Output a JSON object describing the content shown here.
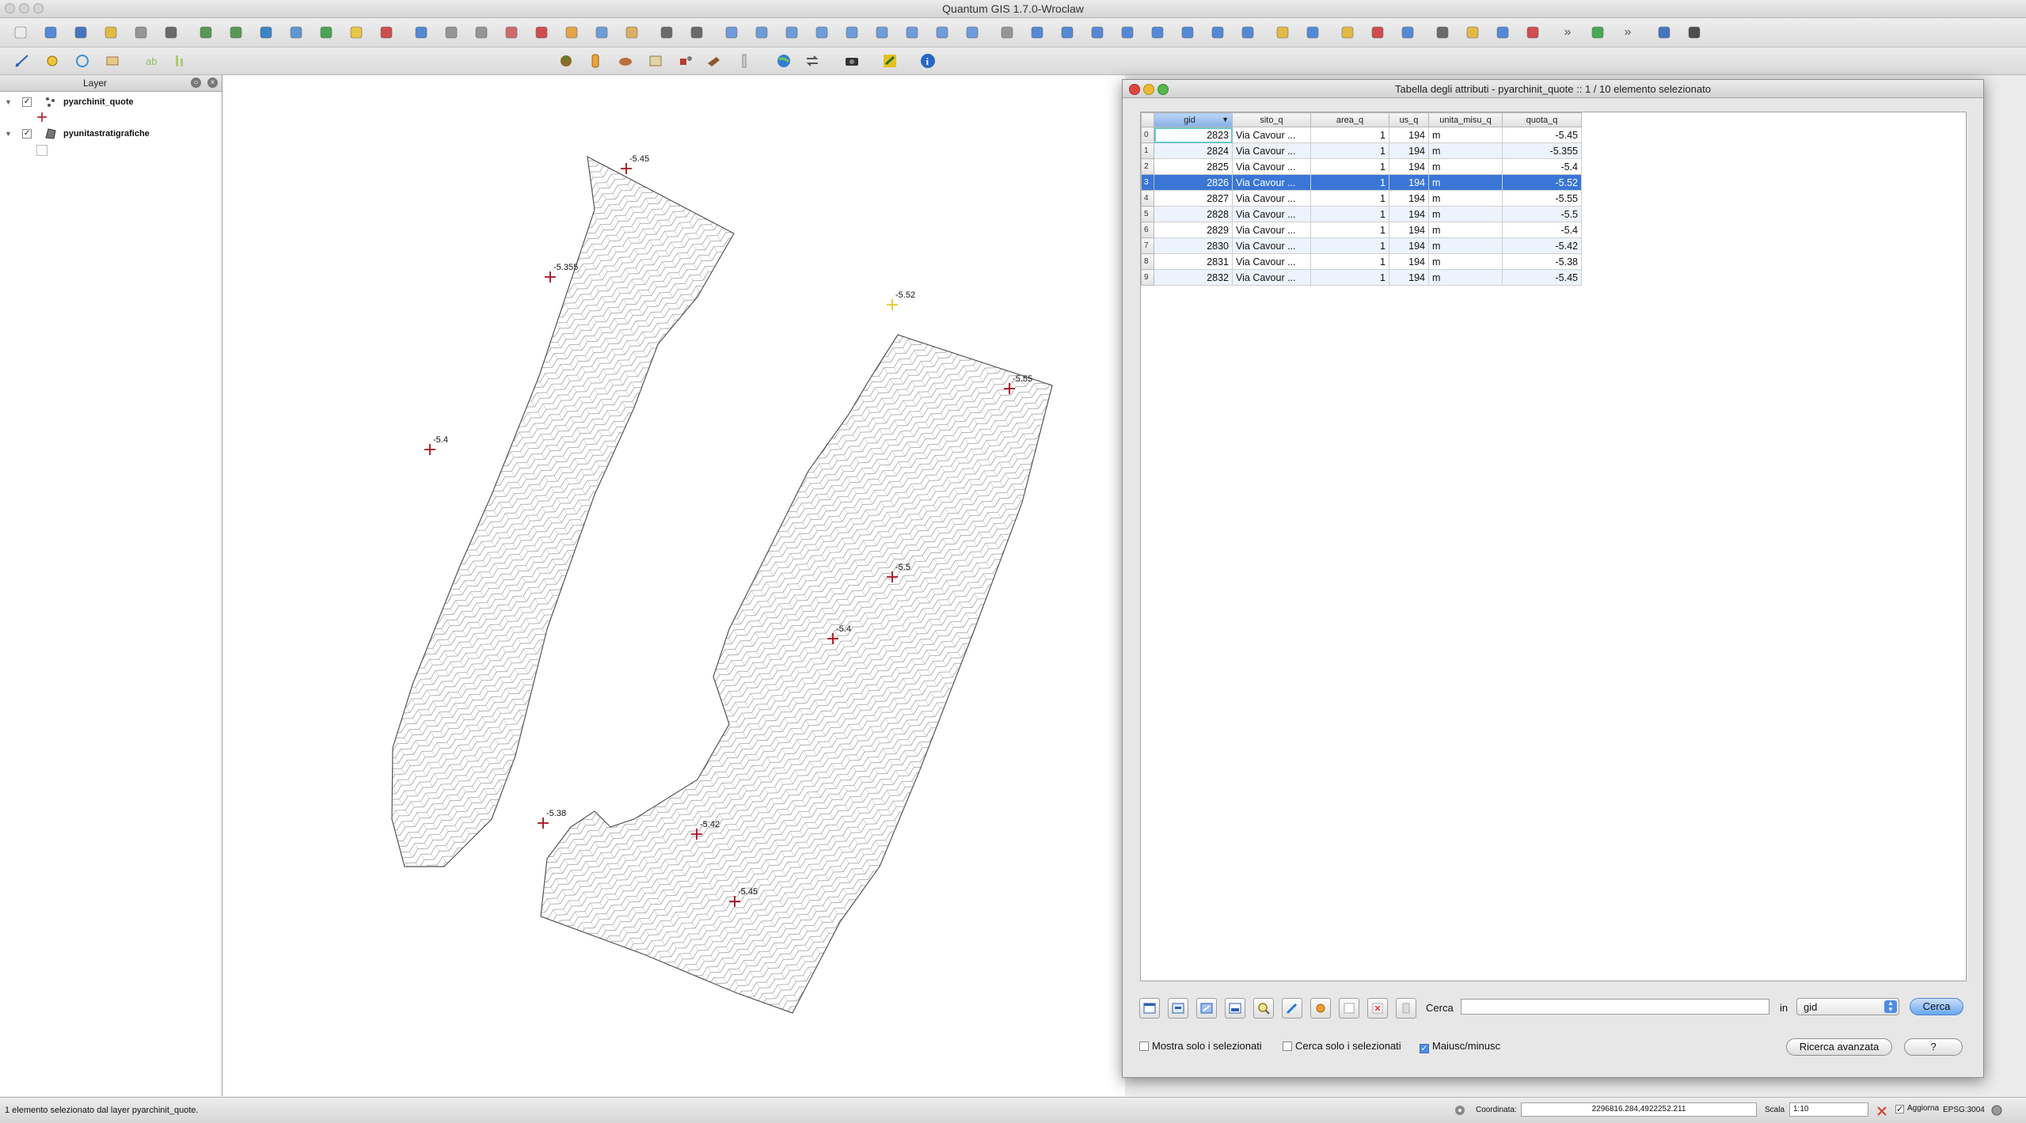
{
  "app": {
    "title": "Quantum GIS 1.7.0-Wroclaw"
  },
  "toolbar_icons": [
    "new-project",
    "open-project",
    "save-project",
    "save-as",
    "print-composer",
    "print",
    "add-vector-layer",
    "add-raster-layer",
    "add-postgis-layer",
    "add-spatialite-layer",
    "add-wms-layer",
    "new-shapefile",
    "remove-layer",
    "toggle-editing",
    "save-edits",
    "capture-point",
    "capture-line",
    "delete-selected",
    "cut-features",
    "copy-features",
    "paste-features",
    "undo",
    "redo",
    "simplify",
    "add-ring",
    "add-part",
    "delete-ring",
    "delete-part",
    "reshape",
    "split",
    "merge",
    "rotate-point",
    "pan",
    "zoom-in",
    "zoom-out",
    "zoom-full",
    "zoom-layer",
    "zoom-selection",
    "zoom-last",
    "zoom-next",
    "refresh",
    "map-tips",
    "identify",
    "select",
    "deselect",
    "attribute-table",
    "measure",
    "annotation",
    "bookmarks",
    "new-bookmark",
    "more",
    "green-leaf",
    "more",
    "python",
    "help"
  ],
  "layer_panel": {
    "title": "Layer",
    "layers": [
      {
        "name": "pyarchinit_quote",
        "checked": true
      },
      {
        "name": "pyunitastratigrafiche",
        "checked": true
      }
    ]
  },
  "map": {
    "labels": [
      "-5.45",
      "-5.355",
      "-5.4",
      "-5.52",
      "-5.55",
      "-5.5",
      "-5.4",
      "-5.38",
      "-5.42",
      "-5.45"
    ]
  },
  "attr_table": {
    "title": "Tabella degli attributi - pyarchinit_quote :: 1 / 10 elemento selezionato",
    "columns": [
      "gid",
      "sito_q",
      "area_q",
      "us_q",
      "unita_misu_q",
      "quota_q"
    ],
    "rows": [
      [
        "0",
        "2823",
        "Via Cavour ...",
        "1",
        "194",
        "m",
        "-5.45"
      ],
      [
        "1",
        "2824",
        "Via Cavour ...",
        "1",
        "194",
        "m",
        "-5.355"
      ],
      [
        "2",
        "2825",
        "Via Cavour ...",
        "1",
        "194",
        "m",
        "-5.4"
      ],
      [
        "3",
        "2826",
        "Via Cavour ...",
        "1",
        "194",
        "m",
        "-5.52"
      ],
      [
        "4",
        "2827",
        "Via Cavour ...",
        "1",
        "194",
        "m",
        "-5.55"
      ],
      [
        "5",
        "2828",
        "Via Cavour ...",
        "1",
        "194",
        "m",
        "-5.5"
      ],
      [
        "6",
        "2829",
        "Via Cavour ...",
        "1",
        "194",
        "m",
        "-5.4"
      ],
      [
        "7",
        "2830",
        "Via Cavour ...",
        "1",
        "194",
        "m",
        "-5.42"
      ],
      [
        "8",
        "2831",
        "Via Cavour ...",
        "1",
        "194",
        "m",
        "-5.38"
      ],
      [
        "9",
        "2832",
        "Via Cavour ...",
        "1",
        "194",
        "m",
        "-5.45"
      ]
    ],
    "selected_row": 3,
    "search_label": "Cerca",
    "search_value": "",
    "in_label": "in",
    "field_select": "gid",
    "search_button": "Cerca",
    "show_selected": "Mostra solo i selezionati",
    "search_selected": "Cerca solo i selezionati",
    "case_sensitive": "Maiusc/minusc",
    "advanced_search": "Ricerca avanzata",
    "help_button": "?"
  },
  "statusbar": {
    "message": "1 elemento selezionato dal layer pyarchinit_quote.",
    "coord_label": "Coordinata:",
    "coord_value": "2296816.284,4922252.211",
    "scale_label": "Scala",
    "scale_value": "1:10",
    "render_label": "Aggiorna",
    "epsg": "EPSG:3004"
  }
}
